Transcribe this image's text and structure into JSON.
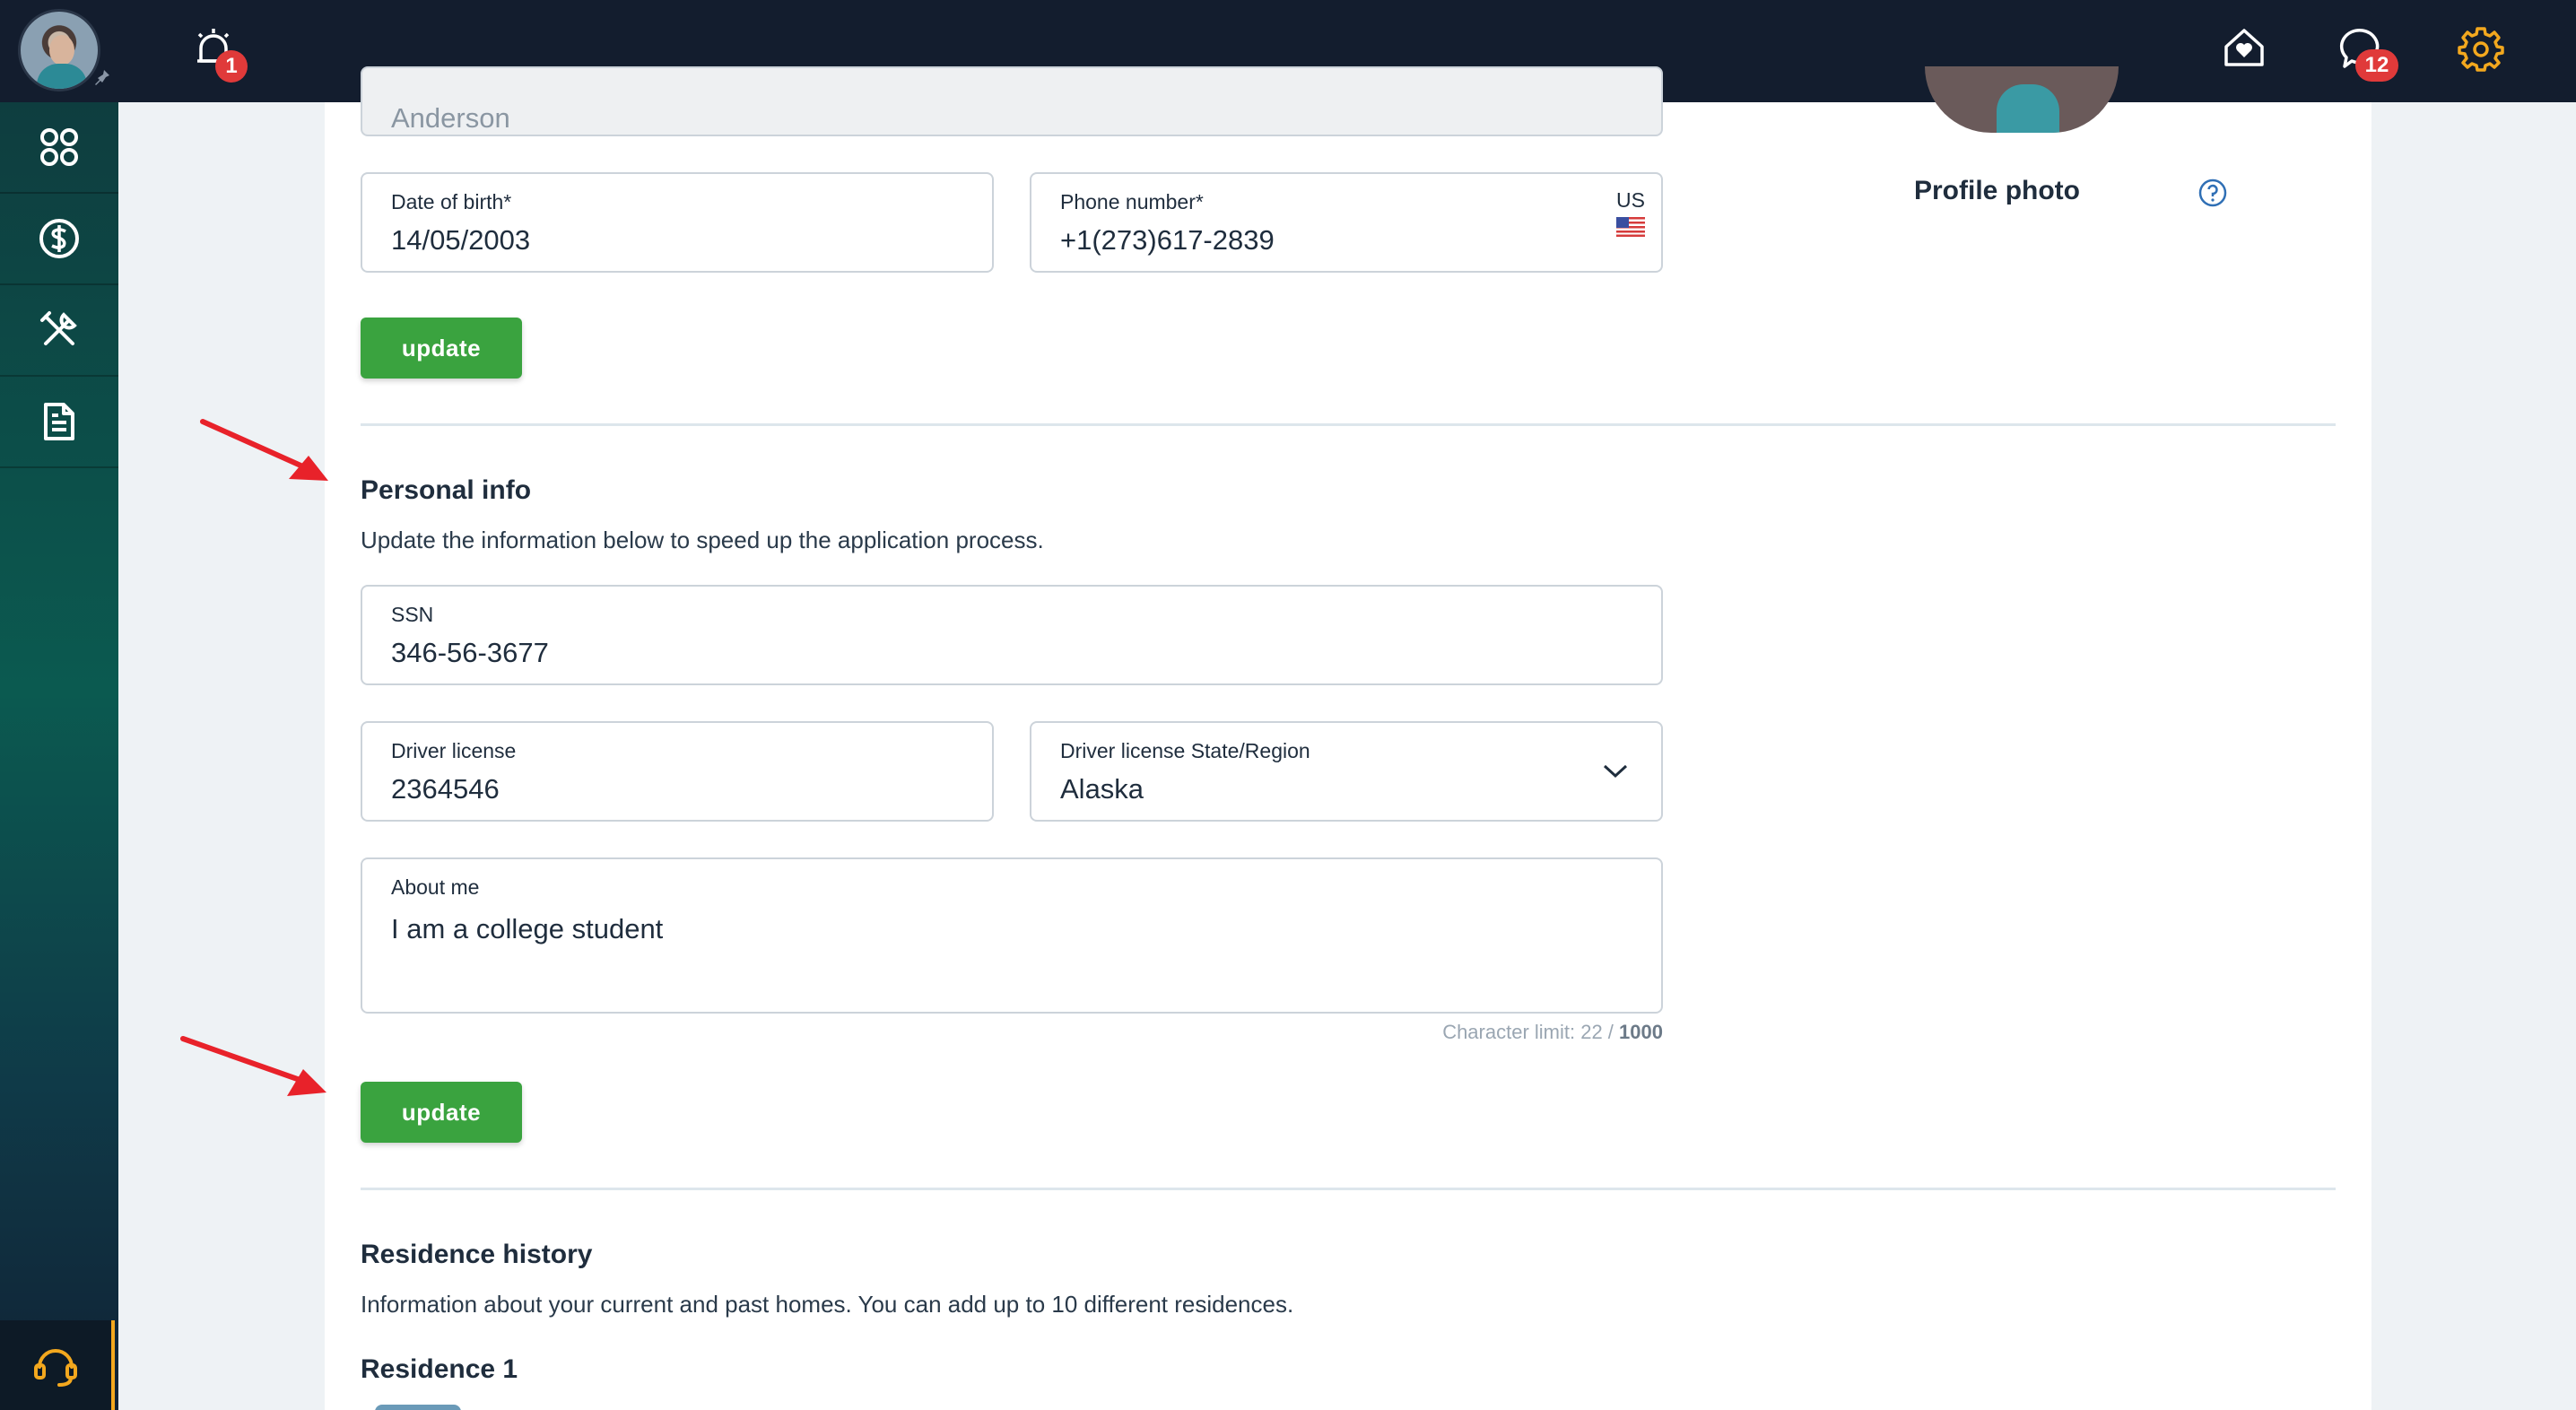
{
  "header": {
    "notification_count": "1",
    "messages_count": "12",
    "icons": [
      "alarm-bell-icon",
      "home-heart-icon",
      "chat-icon",
      "gear-icon"
    ]
  },
  "sidebar": {
    "items": [
      "dashboard-icon",
      "dollar-icon",
      "tools-icon",
      "document-icon"
    ],
    "support": "headset-icon"
  },
  "form": {
    "last_name_value": "Anderson",
    "dob_label": "Date of birth*",
    "dob_value": "14/05/2003",
    "phone_label": "Phone number*",
    "phone_value": "+1(273)617-2839",
    "phone_country": "US",
    "update_label_1": "update"
  },
  "profile": {
    "photo_label": "Profile photo"
  },
  "personal_info": {
    "title": "Personal info",
    "description": "Update the information below to speed up the application process.",
    "ssn_label": "SSN",
    "ssn_value": "346-56-3677",
    "license_label": "Driver license",
    "license_value": "2364546",
    "state_label": "Driver license State/Region",
    "state_value": "Alaska",
    "about_label": "About me",
    "about_value": "I am a college student",
    "char_limit_prefix": "Character limit: 22 /",
    "char_limit_max": "1000",
    "update_label_2": "update"
  },
  "residence": {
    "title": "Residence history",
    "description": "Information about your current and past homes. You can add up to 10 different residences.",
    "subtitle": "Residence 1"
  },
  "colors": {
    "topbar": "#131d2e",
    "accent_green": "#3aa33f",
    "badge_red": "#e03a3a",
    "settings_orange": "#f3a81e",
    "annotation_red": "#e8222a"
  }
}
